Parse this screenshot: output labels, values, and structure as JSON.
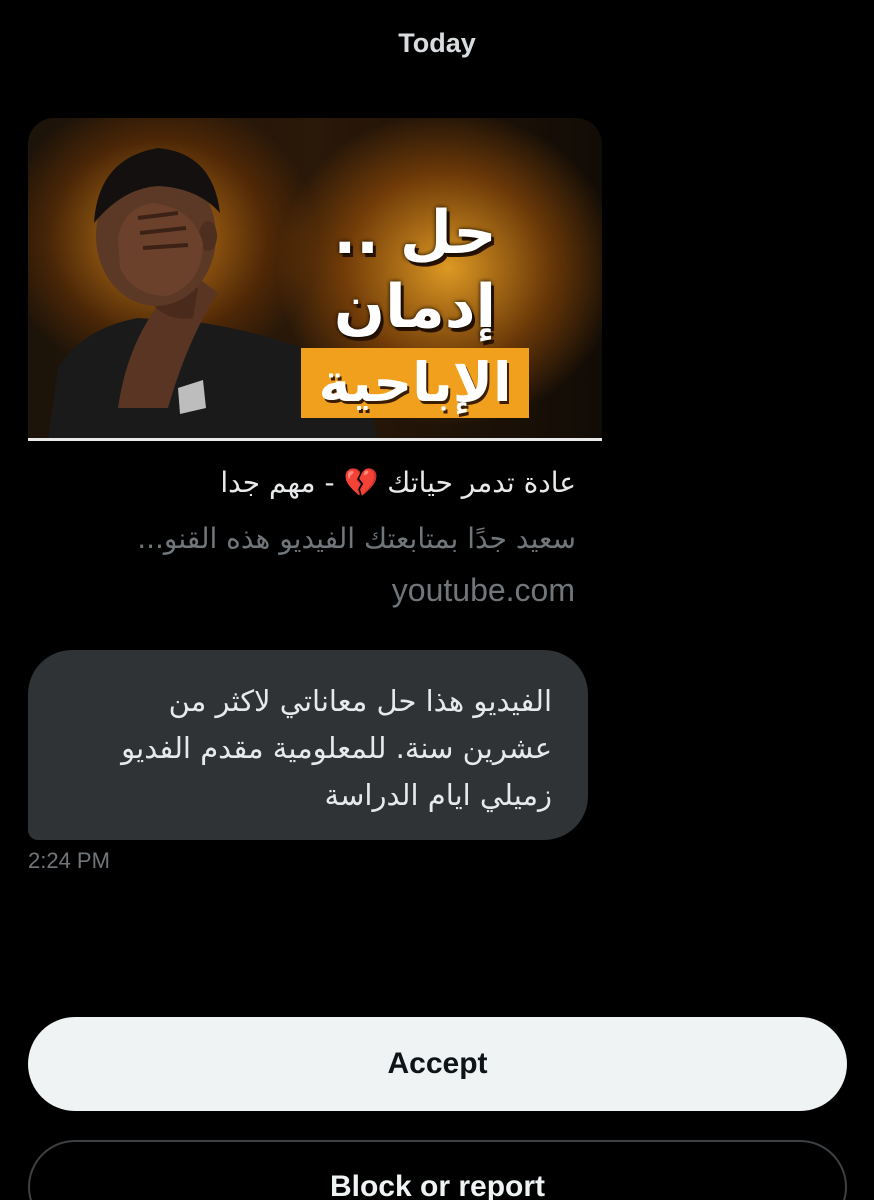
{
  "header": {
    "date_label": "Today"
  },
  "link_preview": {
    "thumbnail": {
      "line1": "حل .. إدمان",
      "line2": "الإباحية",
      "accent_color": "#f0a01c"
    },
    "title": "عادة تدمر حياتك 💔 - مهم جدا",
    "description": "سعيد جدًا بمتابعتك الفيديو هذه القنو...",
    "domain": "youtube.com"
  },
  "message": {
    "lines": [
      "الفيديو هذا حل معاناتي لاكثر من",
      "عشرين سنة. للمعلومية مقدم الفديو",
      "زميلي ايام الدراسة"
    ],
    "timestamp": "2:24 PM"
  },
  "actions": {
    "accept_label": "Accept",
    "block_label": "Block or report"
  }
}
